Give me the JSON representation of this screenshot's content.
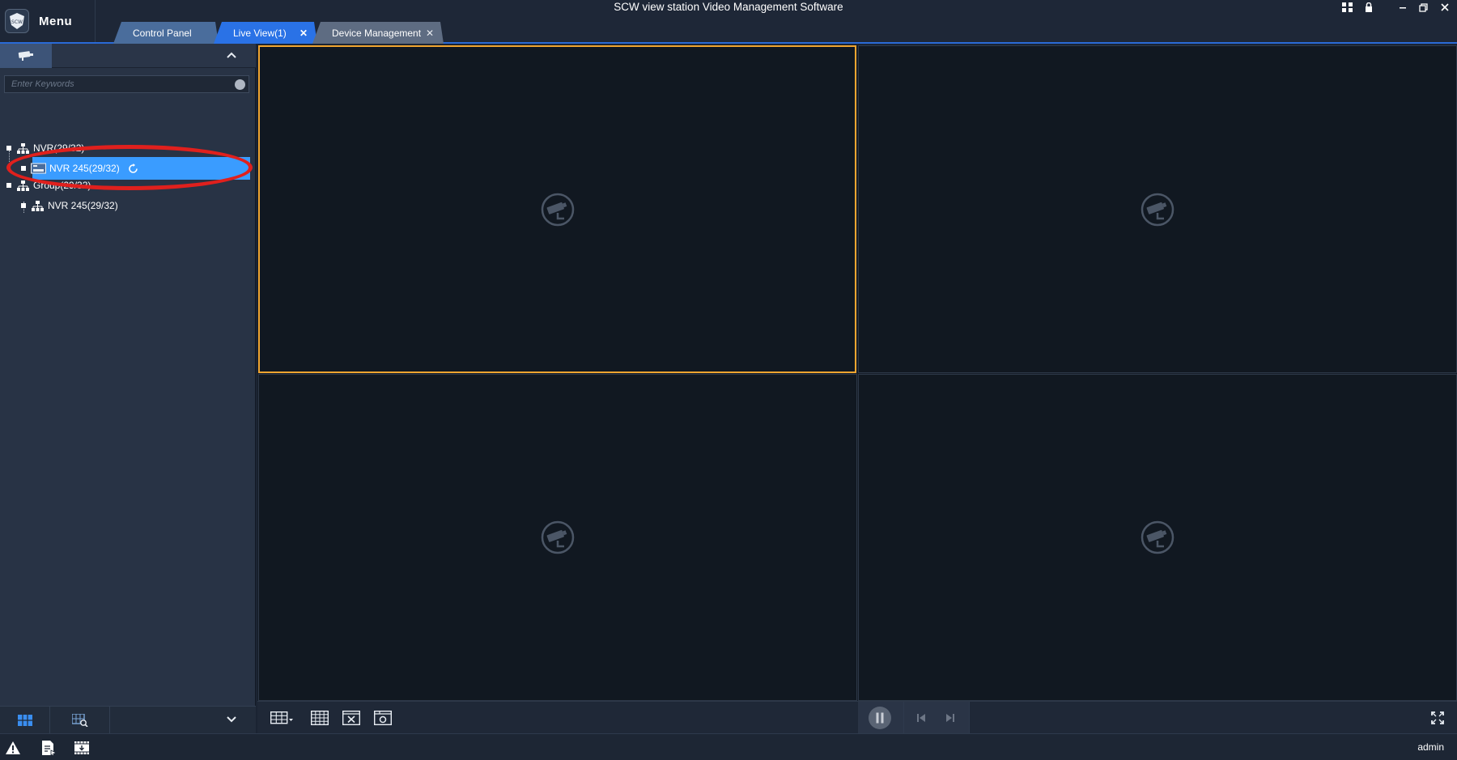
{
  "window": {
    "title": "SCW view station Video Management Software",
    "menu_label": "Menu",
    "logo_text": "SCW"
  },
  "tabs": [
    {
      "label": "Control Panel",
      "closable": false
    },
    {
      "label": "Live View(1)",
      "closable": true,
      "active": true
    },
    {
      "label": "Device Management",
      "closable": true
    }
  ],
  "left_panel": {
    "search_placeholder": "Enter Keywords",
    "tree": [
      {
        "label": "NVR(29/32)",
        "icon": "org-tree-icon"
      },
      {
        "label": "NVR 245(29/32)",
        "icon": "nvr-device-icon",
        "selected": true,
        "loading": true
      },
      {
        "label": "Group(29/32)",
        "icon": "org-tree-icon"
      },
      {
        "label": "NVR 245(29/32)",
        "icon": "org-tree-icon"
      }
    ]
  },
  "video_grid": {
    "layout": "2x2",
    "selected_cell": 1,
    "cells": [
      {
        "state": "no-camera"
      },
      {
        "state": "no-camera"
      },
      {
        "state": "no-camera"
      },
      {
        "state": "no-camera"
      }
    ]
  },
  "status_bar": {
    "user": "admin"
  },
  "colors": {
    "accent": "#2a72e6",
    "selected_row": "#3a9cff",
    "selected_cell_border": "#f0a530",
    "annotation_ellipse": "#e0201d"
  }
}
